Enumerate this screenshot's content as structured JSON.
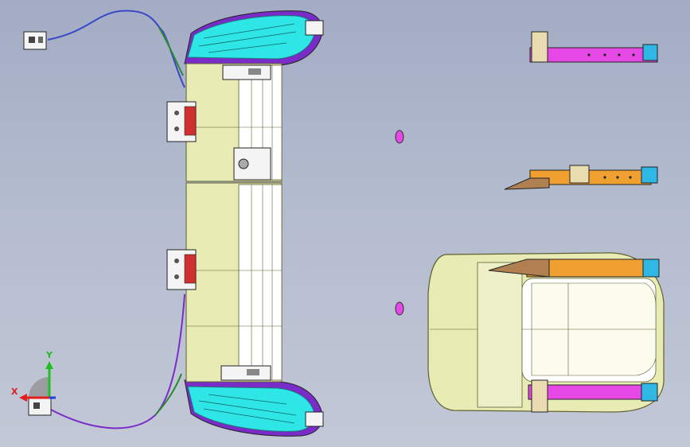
{
  "viewport": {
    "description_free": true,
    "colors": {
      "background_top": "#a3acc4",
      "background_bottom": "#c2c8d6",
      "seat_fill": "#e8ebb4",
      "seat_edge": "#5e6230",
      "trim_cyan": "#2fe6e6",
      "trim_purple": "#7a2cc8",
      "rail_magenta": "#e648e6",
      "rail_orange": "#f0a030",
      "cable_green": "#2a8a2a",
      "cable_blue": "#3a48c8",
      "hinge_red": "#d03030"
    }
  },
  "triad": {
    "x_label": "X",
    "y_label": "Y",
    "x_color": "#e02020",
    "y_color": "#20c020",
    "z_color": "#2040e0"
  },
  "parts": {
    "bench_seat": "bench-seat-assembly",
    "upper_rail": "upper-seat-rail",
    "middle_rail": "middle-seat-rail",
    "seat_cushion": "seat-cushion-assembly"
  }
}
